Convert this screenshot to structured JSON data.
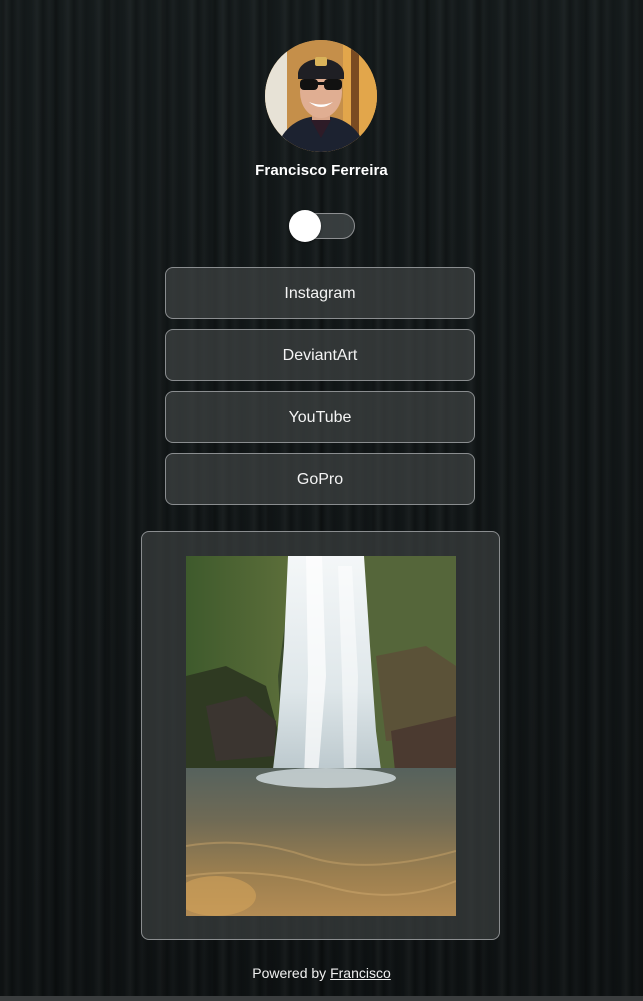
{
  "profile": {
    "name": "Francisco Ferreira",
    "avatar_icon": "profile-photo"
  },
  "theme_toggle": {
    "state": "off"
  },
  "links": [
    {
      "label": "Instagram"
    },
    {
      "label": "DeviantArt"
    },
    {
      "label": "YouTube"
    },
    {
      "label": "GoPro"
    }
  ],
  "featured_image": {
    "subject": "waterfall-photo"
  },
  "footer": {
    "prefix": "Powered by",
    "link_label": "Francisco"
  },
  "colors": {
    "background": "#121718",
    "button_border": "#8a8d8f",
    "button_fill": "#3e4243",
    "text": "#ffffff"
  }
}
